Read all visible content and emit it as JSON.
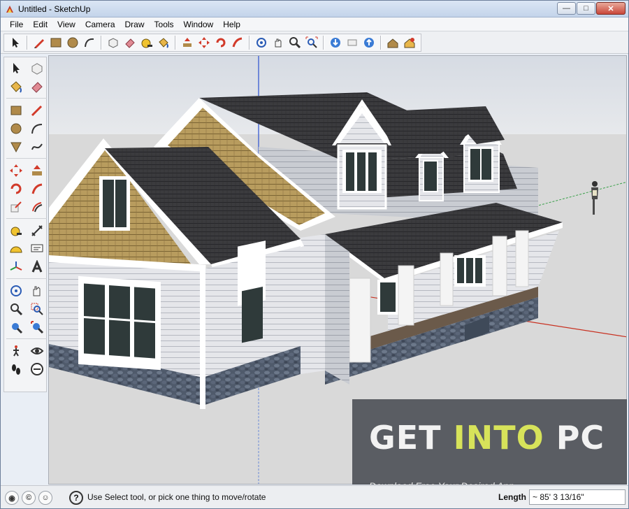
{
  "window": {
    "title": "Untitled - SketchUp",
    "minimize_label": "—",
    "maximize_label": "□",
    "close_label": "✕"
  },
  "menu": [
    "File",
    "Edit",
    "View",
    "Camera",
    "Draw",
    "Tools",
    "Window",
    "Help"
  ],
  "toolbar": {
    "icons": [
      "select-icon",
      "pencil-icon",
      "rectangle-icon",
      "circle-icon",
      "arc-icon",
      "make-component-icon",
      "eraser-icon",
      "tape-measure-icon",
      "paint-bucket-icon",
      "push-pull-icon",
      "move-icon",
      "rotate-icon",
      "follow-me-icon",
      "orbit-icon",
      "pan-icon",
      "zoom-icon",
      "zoom-extents-icon",
      "get-models-icon",
      "share-model-icon",
      "share-component-icon",
      "get-photo-texture-icon",
      "add-location-icon"
    ]
  },
  "left_tools": [
    "select-icon",
    "make-component-icon",
    "paint-bucket-icon",
    "eraser-icon",
    "rectangle-icon",
    "line-icon",
    "circle-icon",
    "arc-icon",
    "polygon-icon",
    "freehand-icon",
    "move-icon",
    "push-pull-icon",
    "rotate-icon",
    "follow-me-icon",
    "scale-icon",
    "offset-icon",
    "tape-measure-icon",
    "dimension-icon",
    "protractor-icon",
    "text-icon",
    "axes-icon",
    "3d-text-icon",
    "orbit-icon",
    "pan-icon",
    "zoom-icon",
    "zoom-window-icon",
    "previous-view-icon",
    "zoom-extents-icon",
    "walk-icon",
    "look-around-icon",
    "footprints-icon",
    "section-plane-icon"
  ],
  "watermark": {
    "get": "GET",
    "into": "INTO",
    "pc": "PC",
    "subtitle": "Download Free Your Desired App"
  },
  "status": {
    "icons": [
      "geo-location-icon",
      "credits-icon",
      "user-icon"
    ],
    "help_label": "?",
    "message": "Use Select tool, or pick one thing to move/rotate",
    "length_label": "Length",
    "length_value": "~ 85' 3 13/16\""
  },
  "colors": {
    "sky": "#dfe3ea",
    "ground": "#d8d8d8",
    "roof": "#3a3a3c",
    "siding": "#e6e6e8",
    "shingle": "#b99e62",
    "stone": "#4f5a6b",
    "trim": "#ffffff",
    "accent_watermark": "#d7e35a"
  }
}
